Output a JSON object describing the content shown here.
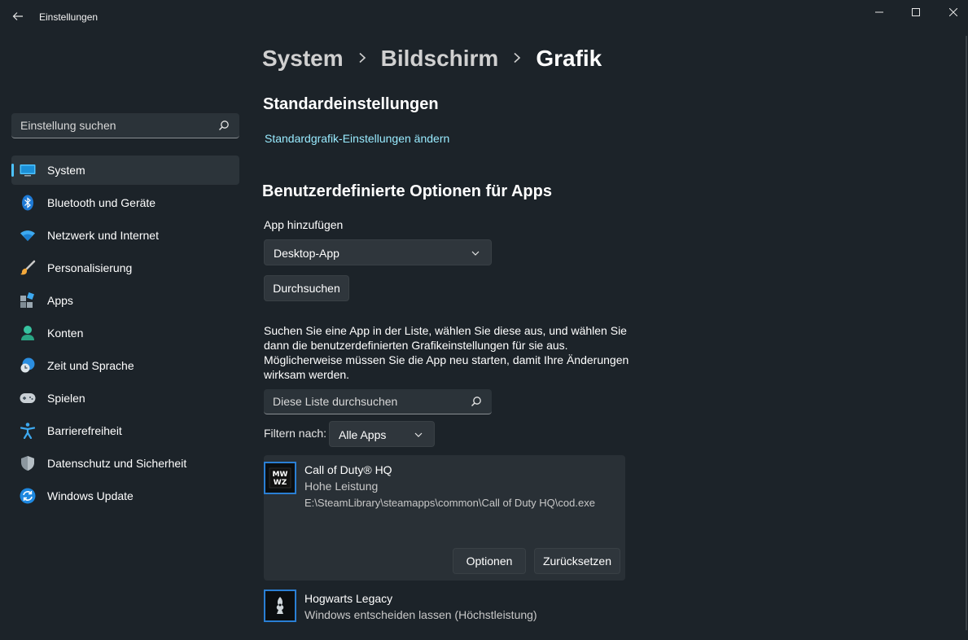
{
  "window": {
    "title": "Einstellungen",
    "back_icon": "arrow-left-icon",
    "minimize_icon": "minimize-icon",
    "maximize_icon": "maximize-icon",
    "close_icon": "close-icon"
  },
  "sidebar": {
    "search_placeholder": "Einstellung suchen",
    "items": [
      {
        "label": "System",
        "icon": "monitor-icon",
        "selected": true
      },
      {
        "label": "Bluetooth und Geräte",
        "icon": "bluetooth-icon",
        "selected": false
      },
      {
        "label": "Netzwerk und Internet",
        "icon": "wifi-icon",
        "selected": false
      },
      {
        "label": "Personalisierung",
        "icon": "brush-icon",
        "selected": false
      },
      {
        "label": "Apps",
        "icon": "apps-icon",
        "selected": false
      },
      {
        "label": "Konten",
        "icon": "person-icon",
        "selected": false
      },
      {
        "label": "Zeit und Sprache",
        "icon": "clock-globe-icon",
        "selected": false
      },
      {
        "label": "Spielen",
        "icon": "gamepad-icon",
        "selected": false
      },
      {
        "label": "Barrierefreiheit",
        "icon": "accessibility-icon",
        "selected": false
      },
      {
        "label": "Datenschutz und Sicherheit",
        "icon": "shield-icon",
        "selected": false
      },
      {
        "label": "Windows Update",
        "icon": "update-icon",
        "selected": false
      }
    ]
  },
  "breadcrumb": [
    "System",
    "Bildschirm",
    "Grafik"
  ],
  "main": {
    "std_heading": "Standardeinstellungen",
    "std_link": "Standardgrafik-Einstellungen ändern",
    "custom_heading": "Benutzerdefinierte Optionen für Apps",
    "add_app_label": "App hinzufügen",
    "add_app_value": "Desktop-App",
    "browse_label": "Durchsuchen",
    "description": "Suchen Sie eine App in der Liste, wählen Sie diese aus, und wählen Sie dann die benutzerdefinierten Grafikeinstellungen für sie aus. Möglicherweise müssen Sie die App neu starten, damit Ihre Änderungen wirksam werden.",
    "list_search_placeholder": "Diese Liste durchsuchen",
    "filter_label": "Filtern nach:",
    "filter_value": "Alle Apps",
    "apps": [
      {
        "name": "Call of Duty® HQ",
        "setting": "Hohe Leistung",
        "path": "E:\\SteamLibrary\\steamapps\\common\\Call of Duty HQ\\cod.exe",
        "icon": "mw-wz-game-icon",
        "icon_text": "MW WZ"
      },
      {
        "name": "Hogwarts Legacy",
        "setting": "Windows entscheiden lassen (Höchstleistung)",
        "icon": "hogwarts-game-icon"
      }
    ],
    "options_label": "Optionen",
    "reset_label": "Zurücksetzen"
  },
  "colors": {
    "accent": "#4cc2ff",
    "link": "#99ebff",
    "background": "#1c2329"
  }
}
